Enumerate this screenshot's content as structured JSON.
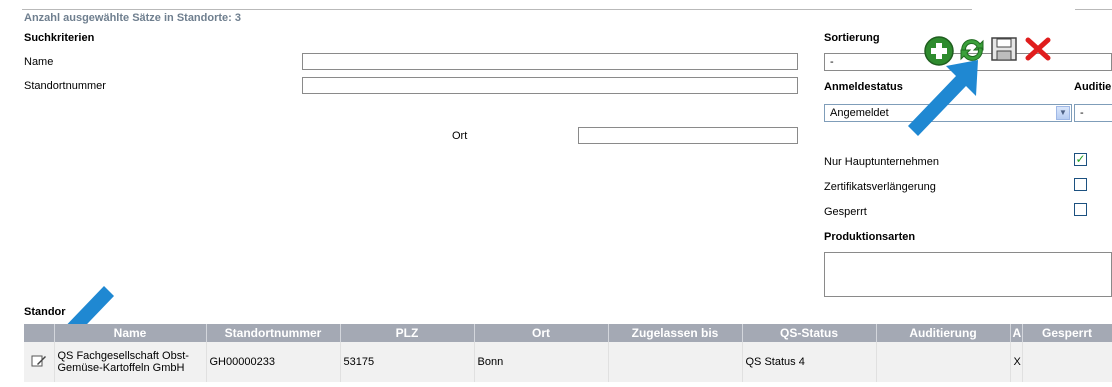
{
  "header": {
    "count_text": "Anzahl ausgewählte Sätze in Standorte: 3"
  },
  "search": {
    "heading": "Suchkriterien",
    "name_label": "Name",
    "name_value": "",
    "standortnummer_label": "Standortnummer",
    "standortnummer_value": "",
    "ort_label": "Ort",
    "ort_value": ""
  },
  "sort": {
    "heading": "Sortierung",
    "value": "-"
  },
  "anmeldestatus": {
    "heading": "Anmeldestatus",
    "value": "Angemeldet"
  },
  "auditierung": {
    "heading": "Auditie",
    "value": "-"
  },
  "flags": {
    "nur_haupt_label": "Nur Hauptunternehmen",
    "nur_haupt_checked": true,
    "zert_label": "Zertifikatsverlängerung",
    "zert_checked": false,
    "gesperrt_label": "Gesperrt",
    "gesperrt_checked": false
  },
  "produktionsarten": {
    "heading": "Produktionsarten",
    "value": ""
  },
  "toolbar": {
    "icons": [
      "add-icon",
      "refresh-icon",
      "save-icon",
      "delete-icon"
    ]
  },
  "results": {
    "section_label": "Standor",
    "columns": [
      "Name",
      "Standortnummer",
      "PLZ",
      "Ort",
      "Zugelassen bis",
      "QS-Status",
      "Auditierung",
      "A",
      "Gesperrt"
    ],
    "rows": [
      {
        "name": "QS Fachgesellschaft Obst-Gemüse-Kartoffeln GmbH",
        "standortnummer": "GH00000233",
        "plz": "53175",
        "ort": "Bonn",
        "zugelassen_bis": "",
        "qs_status": "QS Status 4",
        "auditierung": "",
        "a": "X",
        "gesperrt": ""
      }
    ]
  },
  "colors": {
    "header_bg": "#a4a9b4",
    "arrow": "#1f88d2",
    "count_text": "#6f7f8f"
  }
}
